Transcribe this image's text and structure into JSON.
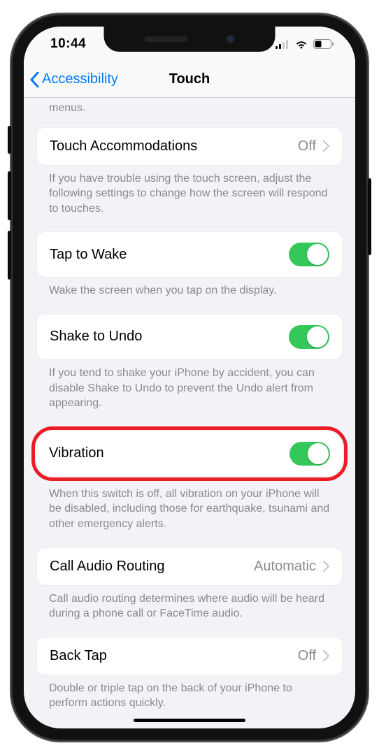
{
  "status": {
    "time": "10:44"
  },
  "nav": {
    "back": "Accessibility",
    "title": "Touch"
  },
  "top_trailing": "menus.",
  "rows": {
    "touch_accom": {
      "label": "Touch Accommodations",
      "value": "Off",
      "footer": "If you have trouble using the touch screen, adjust the following settings to change how the screen will respond to touches."
    },
    "tap_wake": {
      "label": "Tap to Wake",
      "toggle": true,
      "footer": "Wake the screen when you tap on the display."
    },
    "shake_undo": {
      "label": "Shake to Undo",
      "toggle": true,
      "footer": "If you tend to shake your iPhone by accident, you can disable Shake to Undo to prevent the Undo alert from appearing."
    },
    "vibration": {
      "label": "Vibration",
      "toggle": true,
      "footer": "When this switch is off, all vibration on your iPhone will be disabled, including those for earthquake, tsunami and other emergency alerts."
    },
    "call_audio": {
      "label": "Call Audio Routing",
      "value": "Automatic",
      "footer": "Call audio routing determines where audio will be heard during a phone call or FaceTime audio."
    },
    "back_tap": {
      "label": "Back Tap",
      "value": "Off",
      "footer": "Double or triple tap on the back of your iPhone to perform actions quickly."
    }
  }
}
